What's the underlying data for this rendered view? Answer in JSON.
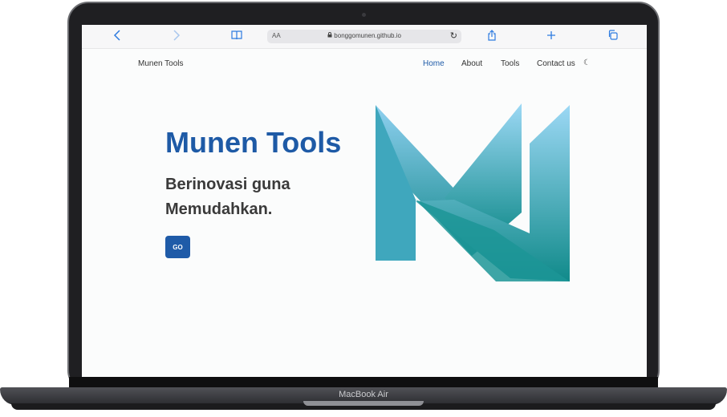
{
  "device": {
    "label": "MacBook Air"
  },
  "browser": {
    "address_aa": "AA",
    "url": "bonggomunen.github.io",
    "icons": [
      "chevron-left-icon",
      "chevron-right-icon",
      "book-icon",
      "lock-icon",
      "reload-icon",
      "share-icon",
      "plus-icon",
      "tabs-icon"
    ]
  },
  "site": {
    "brand": "Munen Tools",
    "nav": {
      "home": "Home",
      "about": "About",
      "tools": "Tools",
      "contact": "Contact us"
    },
    "hero": {
      "title": "Munen Tools",
      "subtitle": "Berinovasi guna Memudahkan.",
      "button": "GO"
    }
  },
  "colors": {
    "accent": "#1f5ba8",
    "logo_light": "#8ecff2",
    "logo_dark": "#138d8d"
  }
}
